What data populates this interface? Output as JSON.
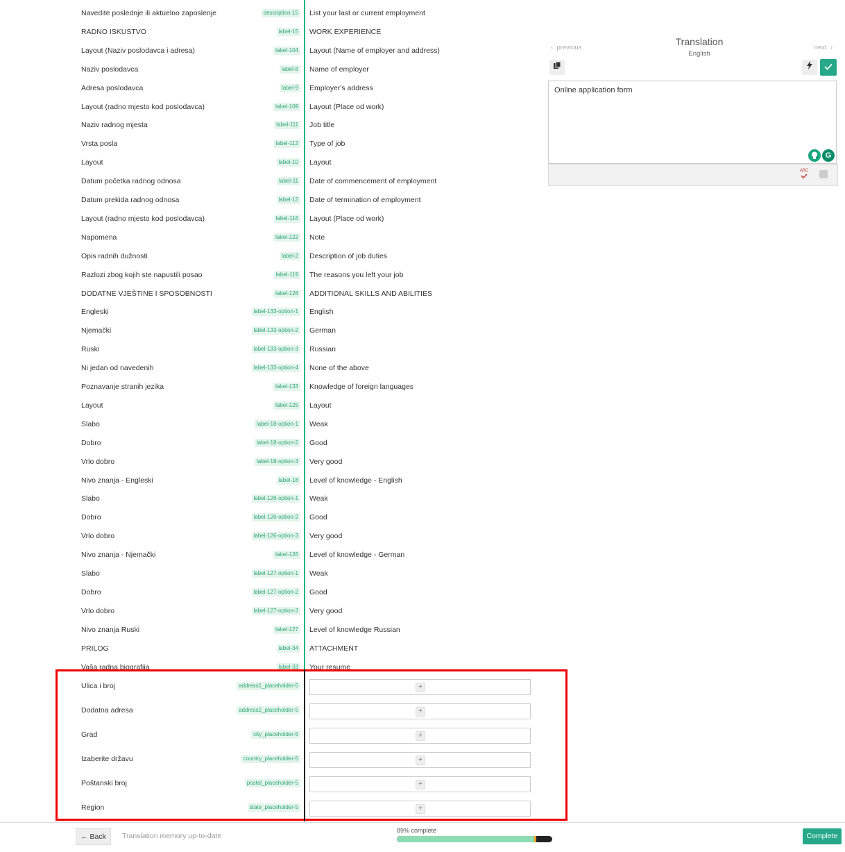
{
  "rows": [
    {
      "source": "Navedite poslednje ili aktuelno zaposlenje",
      "key": "description-15",
      "target": "List your last or current employment"
    },
    {
      "source": "RADNO ISKUSTVO",
      "key": "label-15",
      "target": "WORK EXPERIENCE"
    },
    {
      "source": "Layout (Naziv poslodavca i adresa)",
      "key": "label-104",
      "target": "Layout (Name of employer and address)"
    },
    {
      "source": "Naziv poslodavca",
      "key": "label-8",
      "target": "Name of employer"
    },
    {
      "source": "Adresa poslodavca",
      "key": "label-9",
      "target": "Employer's address"
    },
    {
      "source": "Layout (radno mjesto kod poslodavca)",
      "key": "label-109",
      "target": "Layout (Place od work)"
    },
    {
      "source": "Naziv radnog mjesta",
      "key": "label-111",
      "target": "Job title"
    },
    {
      "source": "Vrsta posla",
      "key": "label-112",
      "target": "Type of job"
    },
    {
      "source": "Layout",
      "key": "label-10",
      "target": "Layout"
    },
    {
      "source": "Datum početka radnog odnosa",
      "key": "label-11",
      "target": "Date of commencement of employment"
    },
    {
      "source": "Datum prekida radnog odnosa",
      "key": "label-12",
      "target": "Date of termination of employment"
    },
    {
      "source": "Layout (radno mjesto kod poslodavca)",
      "key": "label-116",
      "target": "Layout (Place od work)"
    },
    {
      "source": "Napomena",
      "key": "label-122",
      "target": "Note"
    },
    {
      "source": "Opis radnih dužnosti",
      "key": "label-2",
      "target": "Description of job duties"
    },
    {
      "source": "Razlozi zbog kojih ste napustili posao",
      "key": "label-119",
      "target": "The reasons you left your job"
    },
    {
      "source": "DODATNE VJEŠTINE I SPOSOBNOSTI",
      "key": "label-128",
      "target": "ADDITIONAL SKILLS AND ABILITIES"
    },
    {
      "source": "Engleski",
      "key": "label-133-option-1",
      "target": "English"
    },
    {
      "source": "Njemački",
      "key": "label-133-option-2",
      "target": "German"
    },
    {
      "source": "Ruski",
      "key": "label-133-option-3",
      "target": "Russian"
    },
    {
      "source": "Ni jedan od navedenih",
      "key": "label-133-option-4",
      "target": "None of the above"
    },
    {
      "source": "Poznavanje stranih jezika",
      "key": "label-133",
      "target": "Knowledge of foreign languages"
    },
    {
      "source": "Layout",
      "key": "label-125",
      "target": "Layout"
    },
    {
      "source": "Slabo",
      "key": "label-18-option-1",
      "target": "Weak"
    },
    {
      "source": "Dobro",
      "key": "label-18-option-2",
      "target": "Good"
    },
    {
      "source": "Vrlo dobro",
      "key": "label-18-option-3",
      "target": "Very good"
    },
    {
      "source": "Nivo znanja - Engleski",
      "key": "label-18",
      "target": "Level of knowledge - English"
    },
    {
      "source": "Slabo",
      "key": "label-126-option-1",
      "target": "Weak"
    },
    {
      "source": "Dobro",
      "key": "label-126-option-2",
      "target": "Good"
    },
    {
      "source": "Vrlo dobro",
      "key": "label-126-option-3",
      "target": "Very good"
    },
    {
      "source": "Nivo znanja - Njemački",
      "key": "label-126",
      "target": "Level of knowledge - German"
    },
    {
      "source": "Slabo",
      "key": "label-127-option-1",
      "target": "Weak"
    },
    {
      "source": "Dobro",
      "key": "label-127-option-2",
      "target": "Good"
    },
    {
      "source": "Vrlo dobro",
      "key": "label-127-option-3",
      "target": "Very good"
    },
    {
      "source": "Nivo znanja Ruski",
      "key": "label-127",
      "target": "Level of knowledge Russian"
    },
    {
      "source": "PRILOG",
      "key": "label-34",
      "target": "ATTACHMENT"
    },
    {
      "source": "Vaša radna biografija",
      "key": "label-33",
      "target": "Your resume"
    }
  ],
  "empty_rows": [
    {
      "source": "Ulica i broj",
      "key": "address1_placeholder-5",
      "add_label": "+"
    },
    {
      "source": "Dodatna adresa",
      "key": "address2_placeholder-5",
      "add_label": "+"
    },
    {
      "source": "Grad",
      "key": "city_placeholder-5",
      "add_label": "+"
    },
    {
      "source": "Izaberite državu",
      "key": "country_placeholder-5",
      "add_label": "+"
    },
    {
      "source": "Poštanski broj",
      "key": "postal_placeholder-5",
      "add_label": "+"
    },
    {
      "source": "Region",
      "key": "state_placeholder-5",
      "add_label": "+"
    }
  ],
  "panel": {
    "title": "Translation",
    "language": "English",
    "previous": "previous",
    "next": "next",
    "editor_text": "Online application form",
    "spell_label": "ABC",
    "bulb_icon": "lightbulb-icon",
    "grammarly_label": "G"
  },
  "bottom": {
    "back_label": "← Back",
    "tm_status": "Translation memory up-to-date",
    "progress_label": "89% complete",
    "progress_fraction": 0.89,
    "complete_label": "Complete"
  },
  "colors": {
    "accent": "#26a889",
    "highlight": "#ee0000",
    "tag_text": "#2ea579",
    "tag_bg": "#e4f5ec"
  }
}
